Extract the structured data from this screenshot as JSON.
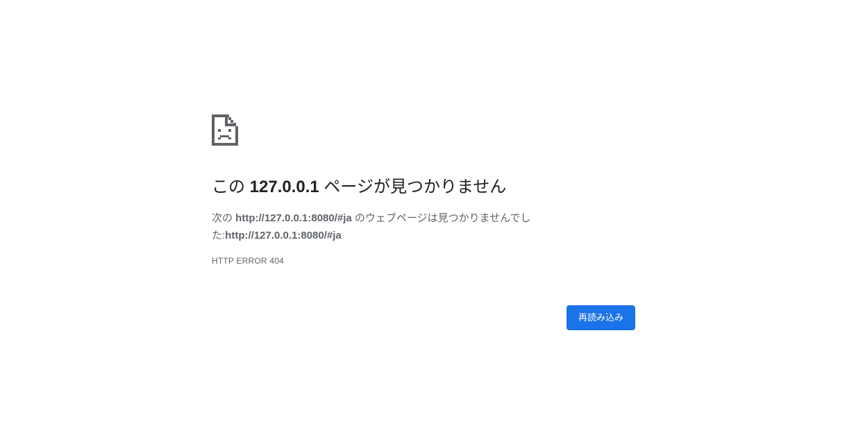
{
  "icon": "sad-page-icon",
  "title": {
    "prefix": "この ",
    "host": "127.0.0.1",
    "suffix": " ページが見つかりません"
  },
  "description": {
    "prefix": "次の ",
    "url_1": "http://127.0.0.1:8080/#ja",
    "middle": " のウェブページは見つかりませんでした:",
    "url_2": "http://127.0.0.1:8080/#ja"
  },
  "error_code": "HTTP ERROR 404",
  "reload_button": {
    "label": "再読み込み"
  },
  "colors": {
    "accent": "#1a73e8",
    "text_primary": "#202124",
    "text_secondary": "#5f6368"
  }
}
